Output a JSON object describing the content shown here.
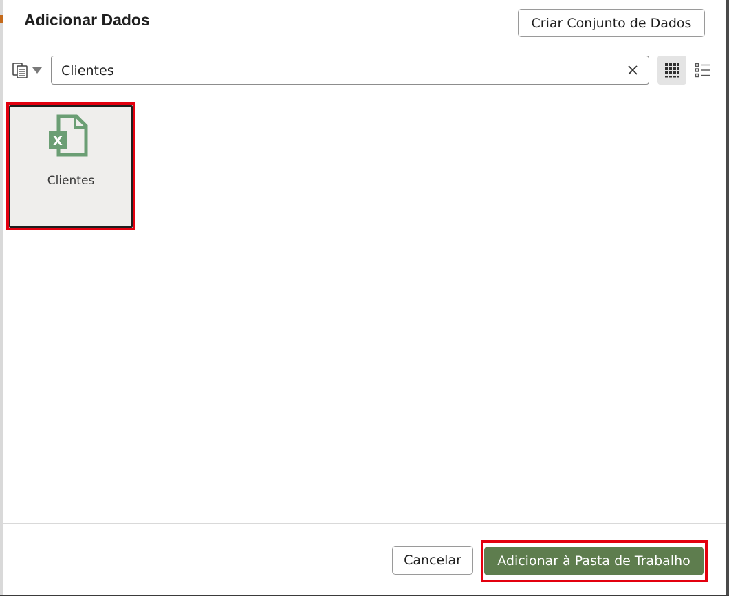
{
  "dialog": {
    "title": "Adicionar Dados",
    "create_dataset_label": "Criar Conjunto de Dados"
  },
  "toolbar": {
    "source_picker_icon": "data-source-icon",
    "search": {
      "value": "Clientes",
      "placeholder": ""
    },
    "clear_icon": "close-icon",
    "grid_view_icon": "grid-view-icon",
    "list_view_icon": "list-view-icon",
    "active_view": "grid"
  },
  "results": [
    {
      "label": "Clientes",
      "icon": "excel-file-icon",
      "selected": true
    }
  ],
  "footer": {
    "cancel_label": "Cancelar",
    "add_label": "Adicionar à Pasta de Trabalho"
  },
  "colors": {
    "primary_button": "#5e7d4e",
    "excel_icon": "#6b9e74",
    "highlight": "#e3000f"
  }
}
